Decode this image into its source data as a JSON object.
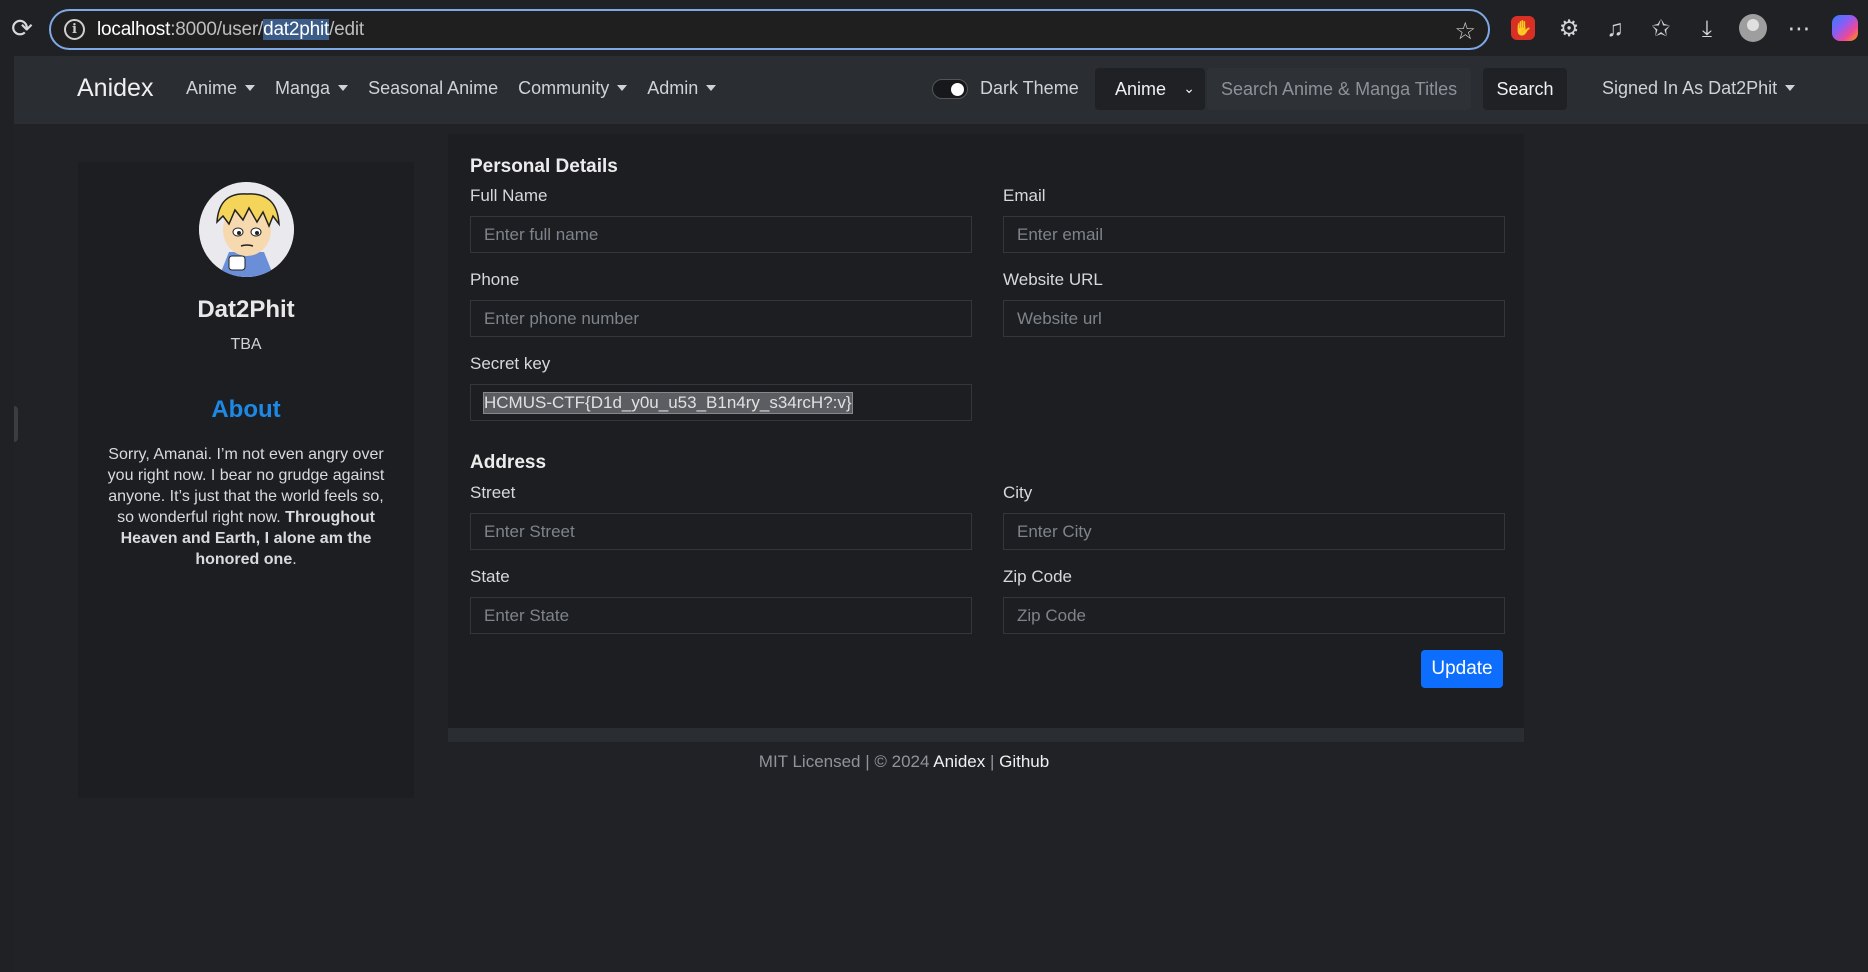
{
  "browser": {
    "url_host": "localhost",
    "url_port_path": ":8000/user/",
    "url_selected": "dat2phit",
    "url_rest": "/edit",
    "icons": [
      "reload-icon",
      "info-icon",
      "star-icon",
      "adblock-icon",
      "extensions-icon",
      "playlist-icon",
      "favorites-icon",
      "downloads-icon",
      "profile-icon",
      "more-icon",
      "copilot-icon"
    ]
  },
  "nav": {
    "brand": "Anidex",
    "items": [
      {
        "label": "Anime",
        "dropdown": true
      },
      {
        "label": "Manga",
        "dropdown": true
      },
      {
        "label": "Seasonal Anime",
        "dropdown": false
      },
      {
        "label": "Community",
        "dropdown": true
      },
      {
        "label": "Admin",
        "dropdown": true
      }
    ],
    "theme_label": "Dark Theme",
    "select_value": "Anime",
    "search_placeholder": "Search Anime & Manga Titles",
    "search_button": "Search",
    "signed_in": "Signed In As Dat2Phit"
  },
  "profile": {
    "name": "Dat2Phit",
    "tagline": "TBA",
    "about_title": "About",
    "about_text": "Sorry, Amanai. I’m not even angry over you right now. I bear no grudge against anyone. It’s just that the world feels so, so wonderful right now.",
    "about_bold": "Throughout Heaven and Earth, I alone am the honored one",
    "about_end": "."
  },
  "form": {
    "personal_title": "Personal Details",
    "full_name_label": "Full Name",
    "full_name_placeholder": "Enter full name",
    "email_label": "Email",
    "email_placeholder": "Enter email",
    "phone_label": "Phone",
    "phone_placeholder": "Enter phone number",
    "website_label": "Website URL",
    "website_placeholder": "Website url",
    "secret_label": "Secret key",
    "secret_value": "HCMUS-CTF{D1d_y0u_u53_B1n4ry_s34rcH?:v}",
    "address_title": "Address",
    "street_label": "Street",
    "street_placeholder": "Enter Street",
    "city_label": "City",
    "city_placeholder": "Enter City",
    "state_label": "State",
    "state_placeholder": "Enter State",
    "zip_label": "Zip Code",
    "zip_placeholder": "Zip Code",
    "update_button": "Update"
  },
  "footer": {
    "text": "MIT Licensed | © 2024",
    "link1": "Anidex",
    "separator": "|",
    "link2": "Github"
  }
}
